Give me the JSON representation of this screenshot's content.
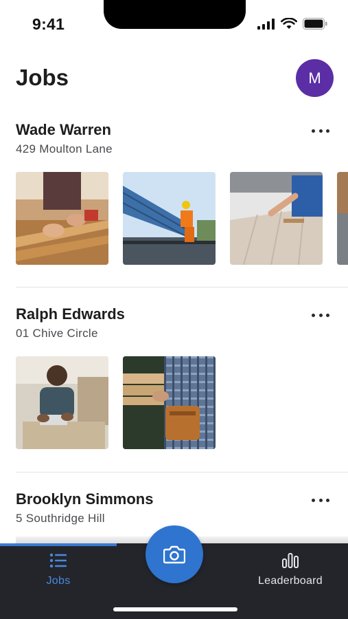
{
  "status_bar": {
    "time": "9:41"
  },
  "header": {
    "title": "Jobs",
    "avatar_initial": "M",
    "avatar_color": "#5b2ea6"
  },
  "jobs": [
    {
      "name": "Wade Warren",
      "address": "429 Moulton Lane",
      "photo_count_visible": 4
    },
    {
      "name": "Ralph Edwards",
      "address": "01 Chive Circle",
      "photo_count_visible": 2
    },
    {
      "name": "Brooklyn Simmons",
      "address": "5 Southridge Hill",
      "photo_count_visible": 0
    }
  ],
  "tabbar": {
    "tabs": [
      {
        "label": "Jobs",
        "icon": "list-icon",
        "active": true
      },
      {
        "label": "Leaderboard",
        "icon": "bar-chart-icon",
        "active": false
      }
    ],
    "center_button_icon": "camera-icon",
    "accent": "#2f74cf",
    "background": "#23252b"
  }
}
